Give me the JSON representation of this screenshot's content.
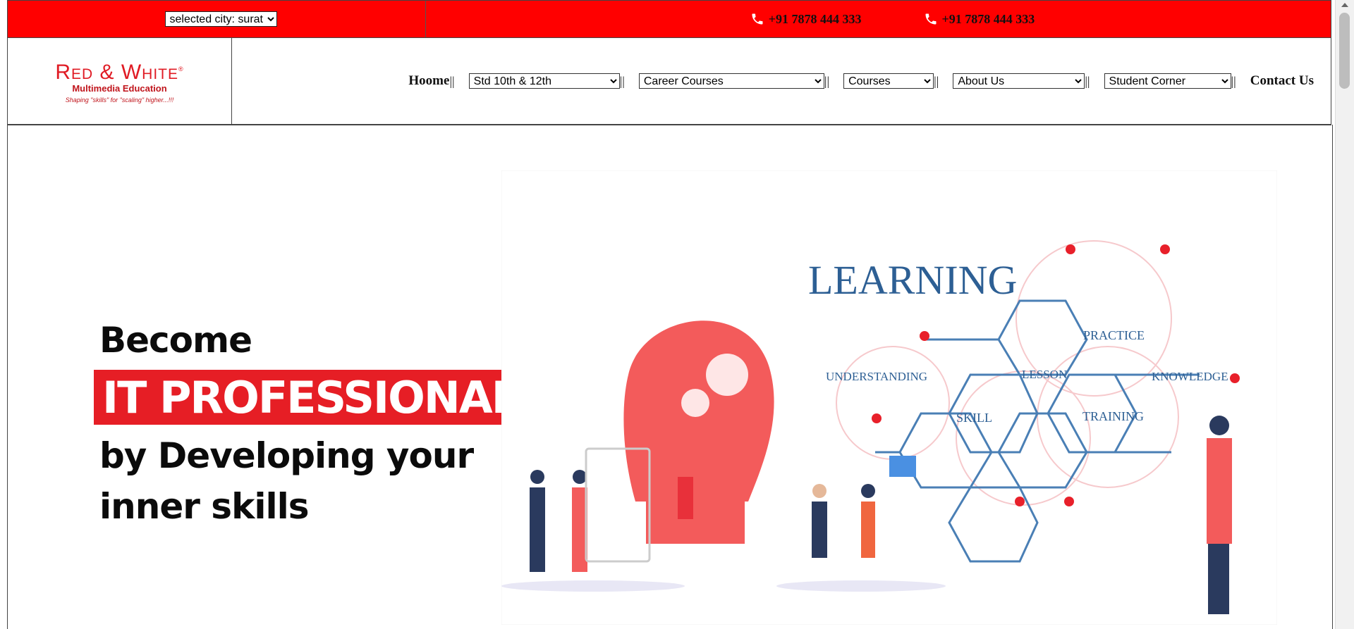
{
  "topbar": {
    "city_select": {
      "value": "selected city: surat",
      "options": [
        "selected city: surat"
      ]
    },
    "phones": [
      "+91 7878 444 333",
      "+91 7878 444 333"
    ],
    "color": "#ff0000"
  },
  "logo": {
    "name": "Red & White",
    "subtitle": "Multimedia Education",
    "tagline": "Shaping \"skills\" for \"scaling\" higher...!!!"
  },
  "nav": {
    "home": "Hoome",
    "separator": "||",
    "std": {
      "value": "Std 10th & 12th"
    },
    "career": {
      "value": "Career Courses"
    },
    "courses": {
      "value": "Courses"
    },
    "about": {
      "value": "About Us"
    },
    "student": {
      "value": "Student Corner"
    },
    "contact": "Contact Us"
  },
  "hero": {
    "line1": "Become",
    "highlight": "IT PROFESSIONAL",
    "line2": "by Developing your",
    "line3": "inner skills",
    "accent": "#e61e25"
  },
  "illustration": {
    "heading": "LEARNING",
    "hex_labels": [
      "PRACTICE",
      "UNDERSTANDING",
      "LESSON",
      "KNOWLEDGE",
      "SKILL",
      "TRAINING"
    ]
  }
}
